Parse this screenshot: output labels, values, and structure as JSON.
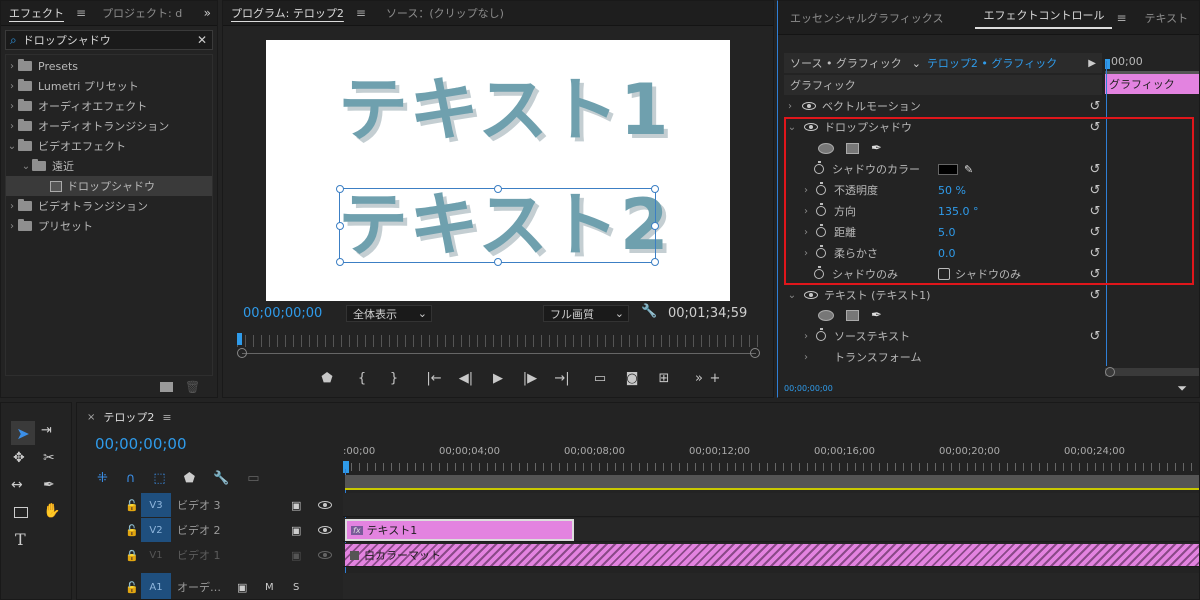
{
  "effects_panel": {
    "tabs": [
      {
        "label": "エフェクト"
      },
      {
        "label": "プロジェクト: d"
      }
    ],
    "search_value": "ドロップシャドウ",
    "tree": [
      {
        "label": "Presets"
      },
      {
        "label": "Lumetri プリセット"
      },
      {
        "label": "オーディオエフェクト"
      },
      {
        "label": "オーディオトランジション"
      },
      {
        "label": "ビデオエフェクト"
      },
      {
        "label": "遠近"
      },
      {
        "label": "ドロップシャドウ"
      },
      {
        "label": "ビデオトランジション"
      },
      {
        "label": "プリセット"
      }
    ]
  },
  "program_monitor": {
    "tabs": [
      {
        "label": "プログラム: テロップ2"
      },
      {
        "label": "ソース：(クリップなし)"
      }
    ],
    "text1": "テキスト1",
    "text2": "テキスト2",
    "timecode_current": "00;00;00;00",
    "timecode_duration": "00;01;34;59",
    "zoom": "全体表示",
    "quality": "フル画質",
    "text_color": "#6fa0ae",
    "shadow_color": "#bcc7cb"
  },
  "effect_controls": {
    "tabs": [
      {
        "label": "エッセンシャルグラフィックス"
      },
      {
        "label": "エフェクトコントロール"
      },
      {
        "label": "テキスト"
      }
    ],
    "source_label": "ソース • グラフィック",
    "target_label": "テロップ2 • グラフィック",
    "section_label": "グラフィック",
    "ruler_time": "00;00",
    "clip_label": "グラフィック",
    "vector_motion": "ベクトルモーション",
    "drop_shadow": "ドロップシャドウ",
    "shadow_color_label": "シャドウのカラー",
    "opacity_label": "不透明度",
    "opacity_value": "50 %",
    "direction_label": "方向",
    "direction_value": "135.0 °",
    "distance_label": "距離",
    "distance_value": "5.0",
    "softness_label": "柔らかさ",
    "softness_value": "0.0",
    "shadow_only_label": "シャドウのみ",
    "shadow_only_checkbox": "シャドウのみ",
    "text_layer": "テキスト (テキスト1)",
    "source_text": "ソーステキスト",
    "transform": "トランスフォーム",
    "bottom_timecode": "00;00;00;00",
    "highlight_color": "#e0161b"
  },
  "timeline": {
    "sequence": "テロップ2",
    "timecode": "00;00;00;00",
    "ruler": [
      ":00;00",
      "00;00;04;00",
      "00;00;08;00",
      "00;00;12;00",
      "00;00;16;00",
      "00;00;20;00",
      "00;00;24;00"
    ],
    "tracks": [
      {
        "id": "V3",
        "name": "ビデオ 3"
      },
      {
        "id": "V2",
        "name": "ビデオ 2"
      },
      {
        "id": "V1",
        "name": "ビデオ 1"
      },
      {
        "id": "A1",
        "name": "オーデ…"
      }
    ],
    "audio_m": "M",
    "audio_s": "S",
    "clip1": "テキスト1",
    "clip1_fx": "fx",
    "clip2": "白カラーマット",
    "clip_color": "#e383e0"
  }
}
